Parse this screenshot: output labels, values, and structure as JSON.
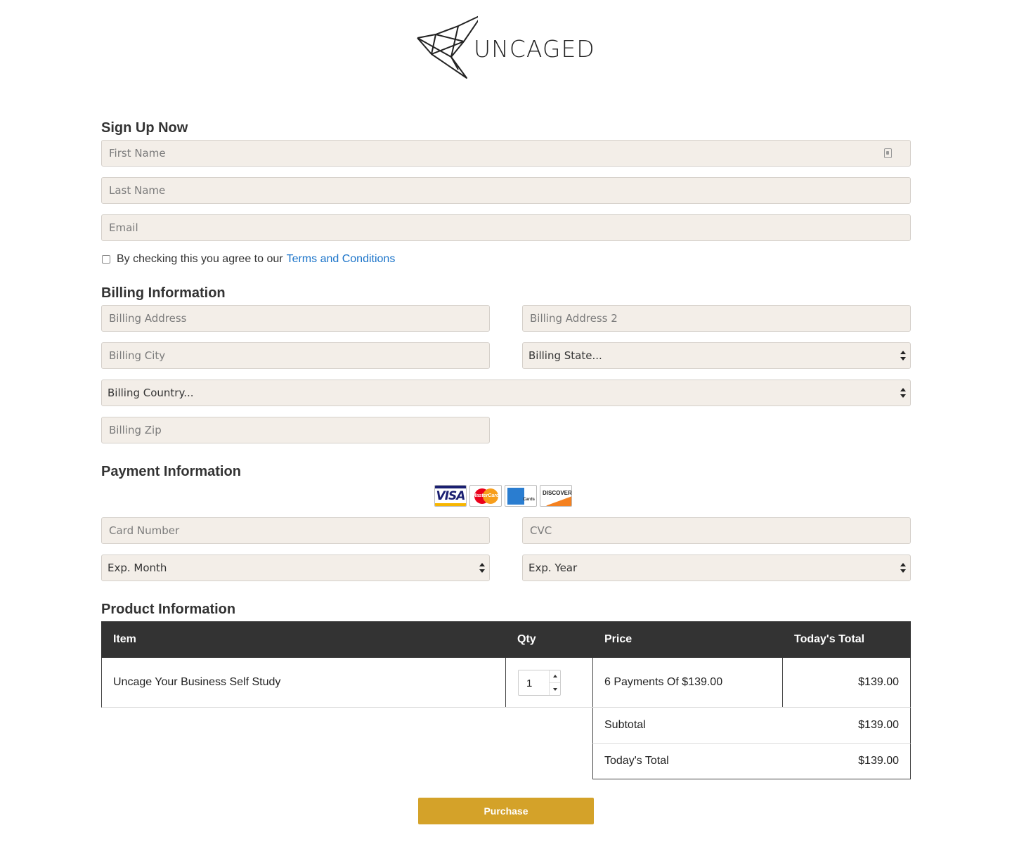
{
  "brand": {
    "name": "UNCAGED",
    "icon": "origami-bird-logo"
  },
  "signup": {
    "heading": "Sign Up Now",
    "first_name_placeholder": "First Name",
    "last_name_placeholder": "Last Name",
    "email_placeholder": "Email",
    "terms_text": "By checking this you agree to our",
    "terms_link": "Terms and Conditions"
  },
  "billing": {
    "heading": "Billing Information",
    "address_placeholder": "Billing Address",
    "address2_placeholder": "Billing Address 2",
    "city_placeholder": "Billing City",
    "state_selected": "Billing State...",
    "country_selected": "Billing Country...",
    "zip_placeholder": "Billing Zip"
  },
  "payment": {
    "heading": "Payment Information",
    "cards": {
      "visa": "VISA",
      "mastercard": "MasterCard",
      "amex": "Cards",
      "discover": "DISCOVER"
    },
    "card_number_placeholder": "Card Number",
    "cvc_placeholder": "CVC",
    "exp_month_selected": "Exp. Month",
    "exp_year_selected": "Exp. Year"
  },
  "product": {
    "heading": "Product Information",
    "columns": {
      "item": "Item",
      "qty": "Qty",
      "price": "Price",
      "total": "Today's Total"
    },
    "rows": [
      {
        "item": "Uncage Your Business Self Study",
        "qty": "1",
        "price": "6 Payments Of $139.00",
        "total": "$139.00"
      }
    ],
    "subtotal_label": "Subtotal",
    "subtotal_value": "$139.00",
    "today_total_label": "Today's Total",
    "today_total_value": "$139.00"
  },
  "purchase_label": "Purchase",
  "colors": {
    "field_bg": "#f3eee8",
    "header_bg": "#333333",
    "button": "#d4a229",
    "link": "#1a73c9"
  }
}
